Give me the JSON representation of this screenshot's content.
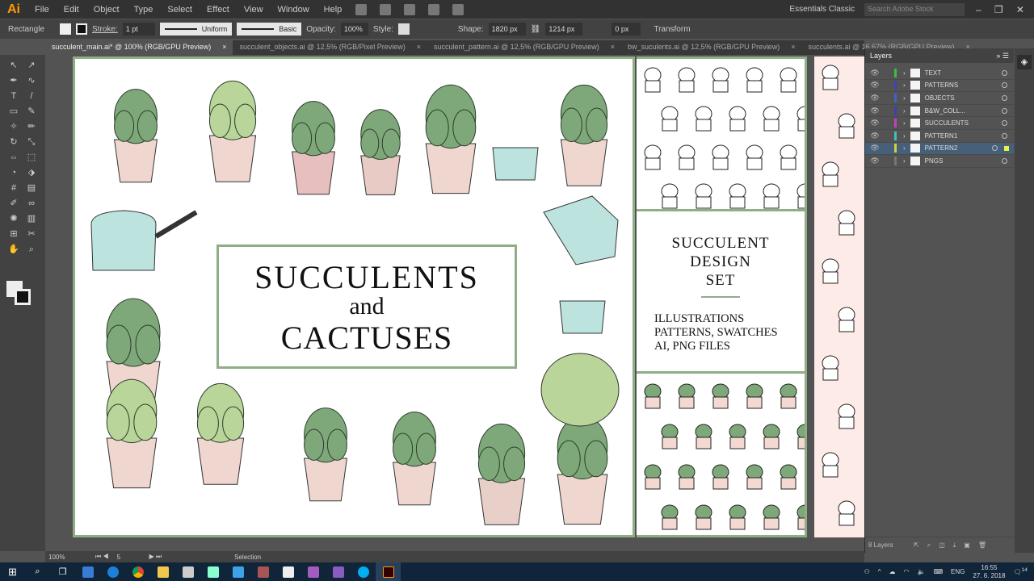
{
  "app": {
    "logo": "Ai",
    "menu": [
      "File",
      "Edit",
      "Object",
      "Type",
      "Select",
      "Effect",
      "View",
      "Window",
      "Help"
    ],
    "workspace": "Essentials Classic",
    "search_placeholder": "Search Adobe Stock"
  },
  "control": {
    "tool": "Rectangle",
    "stroke_label": "Stroke:",
    "stroke_value": "1 pt",
    "profile": "Uniform",
    "brush": "Basic",
    "opacity_label": "Opacity:",
    "opacity": "100%",
    "style_label": "Style:",
    "shape_label": "Shape:",
    "width": "1820 px",
    "height": "1214 px",
    "corner": "0 px",
    "transform": "Transform"
  },
  "tabs": [
    {
      "label": "succulent_main.ai* @ 100% (RGB/GPU Preview)",
      "active": true
    },
    {
      "label": "succulent_objects.ai @ 12,5% (RGB/Pixel Preview)"
    },
    {
      "label": "succulent_pattern.ai @ 12,5% (RGB/GPU Preview)"
    },
    {
      "label": "bw_suculents.ai @ 12,5% (RGB/GPU Preview)"
    },
    {
      "label": "succulents.ai @ 16,67% (RGB/GPU Preview)"
    }
  ],
  "artboard": {
    "title_line1": "SUCCULENTS",
    "title_line2": "and",
    "title_line3": "CACTUSES",
    "side_heading": [
      "SUCCULENT",
      "DESIGN",
      "SET"
    ],
    "side_list": [
      "ILLUSTRATIONS",
      "PATTERNS, SWATCHES",
      "AI, PNG FILES"
    ]
  },
  "layers": {
    "title": "Layers",
    "items": [
      {
        "name": "TEXT",
        "color": "#3fbf3f"
      },
      {
        "name": "PATTERNS",
        "color": "#4040c0"
      },
      {
        "name": "OBJECTS",
        "color": "#4060d0"
      },
      {
        "name": "B&W_COLL...",
        "color": "#4040b0"
      },
      {
        "name": "SUCCULENTS",
        "color": "#c040c0"
      },
      {
        "name": "PATTERN1",
        "color": "#40c0c0"
      },
      {
        "name": "PATTERN2",
        "color": "#d0d040",
        "selected": true
      },
      {
        "name": "PNGS",
        "color": "#777777"
      }
    ],
    "count": "8 Layers"
  },
  "status": {
    "zoom": "100%",
    "artboard": "5",
    "tool": "Selection"
  },
  "taskbar": {
    "lang": "ENG",
    "time": "16:55",
    "date": "27. 6. 2018",
    "notifications": "14"
  }
}
